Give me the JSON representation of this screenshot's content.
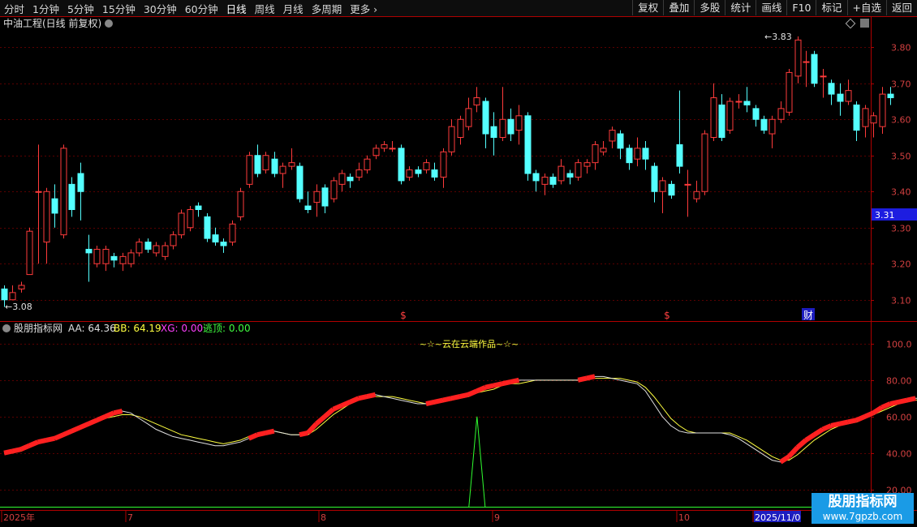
{
  "toolbar": {
    "periods": [
      "分时",
      "1分钟",
      "5分钟",
      "15分钟",
      "30分钟",
      "60分钟",
      "日线",
      "周线",
      "月线",
      "多周期",
      "更多"
    ],
    "active_period": "日线",
    "more_icon": "chevron-right-icon",
    "tools": [
      "复权",
      "叠加",
      "多股",
      "统计",
      "画线",
      "F10",
      "标记",
      "+自选",
      "返回"
    ]
  },
  "main_chart": {
    "title": "中油工程(日线 前复权)",
    "current_price_label": "3.31",
    "high_label": "3.83",
    "low_label": "3.08",
    "markers": [
      {
        "date": "2025-08-11",
        "text": "$"
      },
      {
        "date": "2025-10-10",
        "text": "$"
      },
      {
        "date": "2025-10-27",
        "text": "财"
      }
    ],
    "colors": {
      "up": "#ff3b3b",
      "down": "#54ffff",
      "axis": "#b00000",
      "grid": "#5a0000",
      "price_tag_bg": "#1d1de0"
    }
  },
  "indicator": {
    "name": "股朋指标网",
    "legend": [
      {
        "label": "AA: 64.36",
        "color": "#e0e0e0"
      },
      {
        "label": "BB: 64.19",
        "color": "#ffff40"
      },
      {
        "label": "XG: 0.00",
        "color": "#ff40ff"
      },
      {
        "label": "逃顶: 0.00",
        "color": "#40ff40"
      }
    ],
    "caption": "~☆~云在云端作品~☆~",
    "y_ticks": [
      "100.0",
      "80.00",
      "60.00",
      "40.00",
      "20.00"
    ]
  },
  "date_axis": {
    "labels": [
      "2025年",
      "7",
      "8",
      "9",
      "10",
      "2025/11/0"
    ],
    "cursor_label": "2025/11/0"
  },
  "watermark": {
    "line1": "股朋指标网",
    "line2": "www.7gpzb.com"
  },
  "chart_data": [
    {
      "type": "candlestick",
      "title": "中油工程(日线 前复权)",
      "ylim": [
        3.05,
        3.85
      ],
      "y_ticks": [
        3.1,
        3.2,
        3.3,
        3.4,
        3.5,
        3.6,
        3.7,
        3.8
      ],
      "candles": [
        [
          3.13,
          3.1,
          3.14,
          3.08
        ],
        [
          3.1,
          3.12,
          3.14,
          3.1
        ],
        [
          3.13,
          3.14,
          3.15,
          3.12
        ],
        [
          3.17,
          3.29,
          3.3,
          3.17
        ],
        [
          3.4,
          3.4,
          3.53,
          3.2
        ],
        [
          3.26,
          3.4,
          3.41,
          3.2
        ],
        [
          3.38,
          3.34,
          3.42,
          3.3
        ],
        [
          3.28,
          3.52,
          3.53,
          3.27
        ],
        [
          3.42,
          3.35,
          3.44,
          3.33
        ],
        [
          3.45,
          3.4,
          3.48,
          3.32
        ],
        [
          3.24,
          3.23,
          3.28,
          3.15
        ],
        [
          3.2,
          3.24,
          3.25,
          3.19
        ],
        [
          3.2,
          3.24,
          3.25,
          3.18
        ],
        [
          3.22,
          3.21,
          3.23,
          3.19
        ],
        [
          3.2,
          3.22,
          3.23,
          3.18
        ],
        [
          3.2,
          3.23,
          3.24,
          3.19
        ],
        [
          3.23,
          3.26,
          3.27,
          3.22
        ],
        [
          3.26,
          3.24,
          3.27,
          3.23
        ],
        [
          3.23,
          3.25,
          3.26,
          3.22
        ],
        [
          3.22,
          3.25,
          3.26,
          3.21
        ],
        [
          3.25,
          3.28,
          3.29,
          3.24
        ],
        [
          3.28,
          3.34,
          3.35,
          3.27
        ],
        [
          3.3,
          3.35,
          3.36,
          3.29
        ],
        [
          3.36,
          3.35,
          3.37,
          3.33
        ],
        [
          3.33,
          3.27,
          3.34,
          3.26
        ],
        [
          3.28,
          3.26,
          3.3,
          3.25
        ],
        [
          3.26,
          3.25,
          3.27,
          3.23
        ],
        [
          3.26,
          3.31,
          3.32,
          3.25
        ],
        [
          3.33,
          3.4,
          3.41,
          3.32
        ],
        [
          3.42,
          3.5,
          3.51,
          3.41
        ],
        [
          3.5,
          3.45,
          3.53,
          3.44
        ],
        [
          3.46,
          3.5,
          3.51,
          3.45
        ],
        [
          3.49,
          3.45,
          3.51,
          3.44
        ],
        [
          3.45,
          3.47,
          3.48,
          3.41
        ],
        [
          3.47,
          3.48,
          3.52,
          3.46
        ],
        [
          3.47,
          3.38,
          3.48,
          3.37
        ],
        [
          3.36,
          3.35,
          3.4,
          3.34
        ],
        [
          3.37,
          3.4,
          3.42,
          3.33
        ],
        [
          3.41,
          3.36,
          3.42,
          3.34
        ],
        [
          3.38,
          3.43,
          3.44,
          3.37
        ],
        [
          3.42,
          3.45,
          3.46,
          3.4
        ],
        [
          3.44,
          3.43,
          3.45,
          3.41
        ],
        [
          3.44,
          3.46,
          3.48,
          3.43
        ],
        [
          3.46,
          3.49,
          3.5,
          3.45
        ],
        [
          3.5,
          3.52,
          3.53,
          3.49
        ],
        [
          3.52,
          3.53,
          3.54,
          3.51
        ],
        [
          3.52,
          3.52,
          3.54,
          3.51
        ],
        [
          3.52,
          3.43,
          3.53,
          3.42
        ],
        [
          3.44,
          3.46,
          3.47,
          3.43
        ],
        [
          3.46,
          3.45,
          3.47,
          3.44
        ],
        [
          3.46,
          3.48,
          3.49,
          3.45
        ],
        [
          3.46,
          3.44,
          3.48,
          3.43
        ],
        [
          3.44,
          3.51,
          3.52,
          3.41
        ],
        [
          3.51,
          3.58,
          3.6,
          3.5
        ],
        [
          3.55,
          3.6,
          3.61,
          3.53
        ],
        [
          3.58,
          3.63,
          3.66,
          3.57
        ],
        [
          3.64,
          3.66,
          3.69,
          3.62
        ],
        [
          3.65,
          3.56,
          3.66,
          3.52
        ],
        [
          3.58,
          3.55,
          3.62,
          3.5
        ],
        [
          3.55,
          3.6,
          3.69,
          3.54
        ],
        [
          3.6,
          3.56,
          3.63,
          3.54
        ],
        [
          3.57,
          3.61,
          3.64,
          3.53
        ],
        [
          3.61,
          3.45,
          3.62,
          3.43
        ],
        [
          3.45,
          3.43,
          3.46,
          3.4
        ],
        [
          3.42,
          3.44,
          3.45,
          3.39
        ],
        [
          3.44,
          3.42,
          3.45,
          3.41
        ],
        [
          3.43,
          3.47,
          3.49,
          3.42
        ],
        [
          3.45,
          3.44,
          3.46,
          3.42
        ],
        [
          3.44,
          3.48,
          3.49,
          3.43
        ],
        [
          3.47,
          3.48,
          3.49,
          3.45
        ],
        [
          3.48,
          3.53,
          3.54,
          3.46
        ],
        [
          3.51,
          3.52,
          3.54,
          3.5
        ],
        [
          3.54,
          3.57,
          3.58,
          3.52
        ],
        [
          3.56,
          3.52,
          3.57,
          3.49
        ],
        [
          3.52,
          3.48,
          3.53,
          3.46
        ],
        [
          3.49,
          3.52,
          3.55,
          3.47
        ],
        [
          3.52,
          3.49,
          3.54,
          3.46
        ],
        [
          3.47,
          3.4,
          3.48,
          3.37
        ],
        [
          3.4,
          3.43,
          3.44,
          3.34
        ],
        [
          3.42,
          3.39,
          3.43,
          3.38
        ],
        [
          3.53,
          3.47,
          3.68,
          3.45
        ],
        [
          3.42,
          3.42,
          3.46,
          3.33
        ],
        [
          3.38,
          3.4,
          3.43,
          3.37
        ],
        [
          3.4,
          3.56,
          3.57,
          3.39
        ],
        [
          3.55,
          3.66,
          3.7,
          3.54
        ],
        [
          3.64,
          3.55,
          3.67,
          3.54
        ],
        [
          3.57,
          3.65,
          3.66,
          3.56
        ],
        [
          3.65,
          3.65,
          3.67,
          3.63
        ],
        [
          3.65,
          3.64,
          3.69,
          3.62
        ],
        [
          3.63,
          3.6,
          3.64,
          3.58
        ],
        [
          3.6,
          3.57,
          3.61,
          3.56
        ],
        [
          3.56,
          3.6,
          3.61,
          3.52
        ],
        [
          3.6,
          3.63,
          3.65,
          3.59
        ],
        [
          3.62,
          3.73,
          3.74,
          3.61
        ],
        [
          3.72,
          3.82,
          3.83,
          3.7
        ],
        [
          3.76,
          3.76,
          3.79,
          3.69
        ],
        [
          3.78,
          3.7,
          3.79,
          3.69
        ],
        [
          3.72,
          3.72,
          3.74,
          3.66
        ],
        [
          3.7,
          3.67,
          3.71,
          3.64
        ],
        [
          3.67,
          3.65,
          3.7,
          3.61
        ],
        [
          3.65,
          3.68,
          3.71,
          3.64
        ],
        [
          3.64,
          3.57,
          3.65,
          3.54
        ],
        [
          3.58,
          3.63,
          3.64,
          3.55
        ],
        [
          3.59,
          3.61,
          3.62,
          3.55
        ],
        [
          3.58,
          3.67,
          3.69,
          3.56
        ],
        [
          3.67,
          3.66,
          3.69,
          3.64
        ]
      ]
    },
    {
      "type": "line",
      "title": "股朋指标网",
      "ylim": [
        10,
        108
      ],
      "y_ticks": [
        100,
        80,
        60,
        40,
        20
      ],
      "series": [
        {
          "name": "AA",
          "color": "#e0e0e0",
          "values": [
            40,
            41,
            42,
            44,
            46,
            47,
            48,
            50,
            52,
            54,
            56,
            58,
            60,
            62,
            63,
            62,
            59,
            56,
            53,
            51,
            49,
            48,
            47,
            46,
            45,
            44,
            44,
            45,
            46,
            48,
            50,
            51,
            52,
            51,
            50,
            50,
            51,
            56,
            60,
            64,
            66,
            68,
            70,
            71,
            72,
            71,
            70,
            69,
            68,
            67,
            67,
            68,
            69,
            70,
            71,
            72,
            74,
            76,
            77,
            78,
            79,
            80,
            80,
            80,
            80,
            80,
            80,
            80,
            80,
            81,
            82,
            82,
            81,
            80,
            79,
            78,
            74,
            67,
            60,
            55,
            52,
            51,
            51,
            51,
            51,
            51,
            50,
            48,
            45,
            42,
            39,
            36,
            35,
            38,
            43,
            47,
            50,
            53,
            55,
            56,
            57,
            58,
            60,
            62,
            65,
            67,
            68,
            69,
            70,
            70,
            70,
            69,
            68,
            67,
            65,
            64,
            64
          ]
        },
        {
          "name": "BB",
          "color": "#ffff40",
          "values": [
            40,
            40,
            41,
            43,
            45,
            46,
            48,
            49,
            51,
            53,
            55,
            57,
            59,
            60,
            61,
            61,
            60,
            58,
            56,
            54,
            52,
            50,
            49,
            48,
            47,
            46,
            45,
            46,
            47,
            49,
            50,
            51,
            52,
            51,
            50,
            50,
            50,
            53,
            57,
            61,
            64,
            67,
            69,
            70,
            71,
            71,
            71,
            70,
            69,
            68,
            67,
            67,
            68,
            69,
            70,
            71,
            73,
            74,
            75,
            77,
            78,
            78,
            79,
            80,
            80,
            80,
            80,
            80,
            80,
            80,
            81,
            81,
            81,
            81,
            80,
            79,
            76,
            71,
            65,
            59,
            55,
            52,
            51,
            51,
            51,
            51,
            51,
            49,
            47,
            44,
            41,
            38,
            36,
            36,
            39,
            43,
            47,
            50,
            53,
            55,
            56,
            57,
            59,
            61,
            63,
            65,
            67,
            68,
            69,
            70,
            70,
            70,
            69,
            68,
            67,
            65,
            64
          ]
        },
        {
          "name": "XG",
          "color": "#ff40ff",
          "values": []
        },
        {
          "name": "逃顶",
          "color": "#40ff40",
          "values": [
            0,
            0,
            0,
            0,
            0,
            0,
            0,
            0,
            0,
            0,
            0,
            0,
            0,
            0,
            0,
            0,
            0,
            0,
            0,
            0,
            0,
            0,
            0,
            0,
            0,
            0,
            0,
            0,
            0,
            0,
            0,
            0,
            0,
            0,
            0,
            0,
            0,
            0,
            0,
            0,
            0,
            0,
            0,
            0,
            0,
            0,
            0,
            0,
            0,
            0,
            0,
            0,
            0,
            0,
            0,
            0,
            0,
            0,
            0,
            0,
            0,
            0,
            0,
            0,
            0,
            0,
            0,
            0,
            0,
            0,
            0,
            0,
            0,
            0,
            0,
            0,
            0,
            0,
            0,
            0,
            0,
            0,
            0,
            0,
            0,
            0,
            0,
            0,
            0,
            0,
            0,
            0,
            0,
            0,
            0,
            0,
            0,
            0,
            0,
            0,
            0,
            0,
            0,
            0,
            0,
            0,
            0,
            0,
            0,
            0,
            0,
            0,
            0,
            0,
            0,
            0,
            0
          ]
        }
      ],
      "signal": {
        "index": 57,
        "value": 60
      }
    }
  ]
}
